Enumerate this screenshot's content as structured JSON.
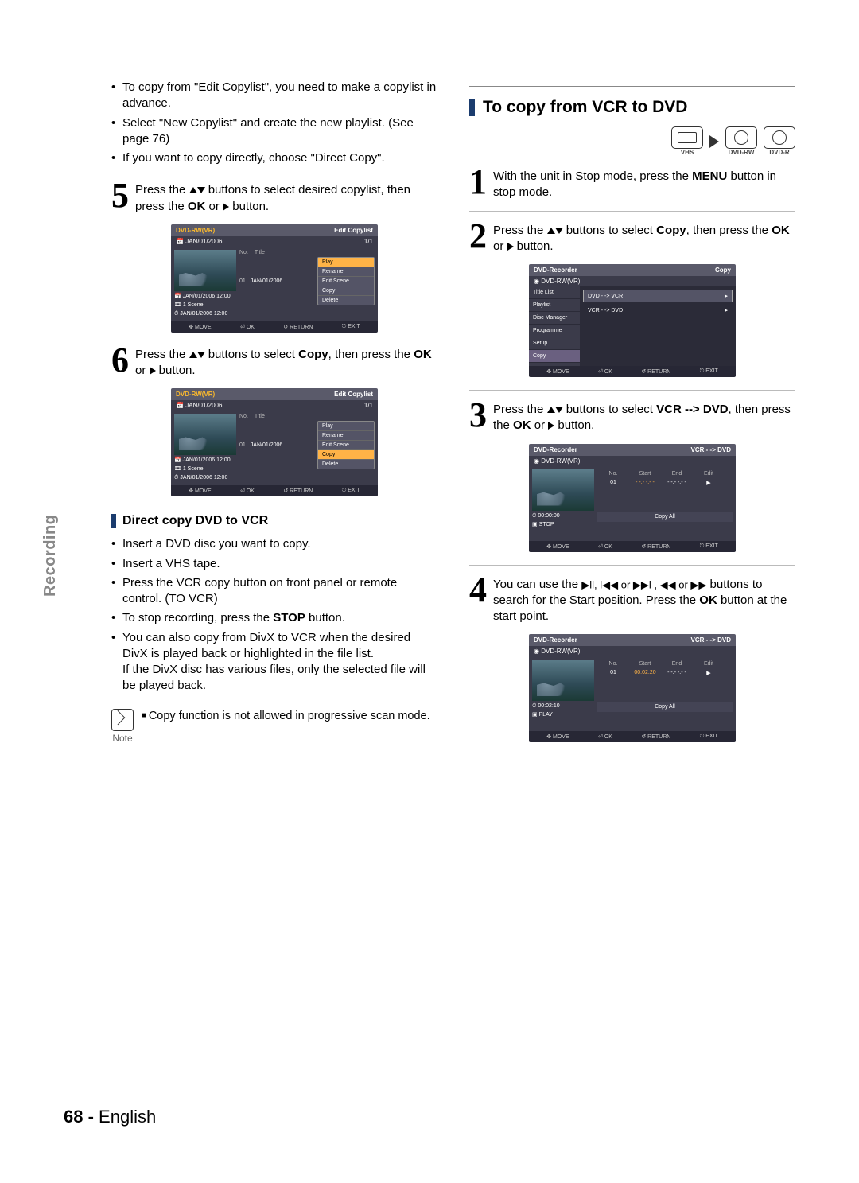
{
  "sidetab": "Recording",
  "footer": {
    "page": "68 -",
    "lang": "English"
  },
  "left": {
    "pre_bullets": [
      "To copy from \"Edit Copylist\", you need to make a copylist in advance.",
      "Select \"New Copylist\" and create the new playlist. (See page 76)",
      "If you want to copy directly, choose \"Direct Copy\"."
    ],
    "step5": {
      "num": "5",
      "text_a": "Press the ",
      "text_b": " buttons to select desired copylist, then press the ",
      "ok": "OK",
      "text_c": " or ",
      "text_d": " button."
    },
    "osd1": {
      "title_l": "DVD-RW(VR)",
      "title_r": "Edit Copylist",
      "sub_l": "JAN/01/2006",
      "sub_r": "1/1",
      "cols": {
        "no": "No.",
        "title": "Title"
      },
      "row_idx": "01",
      "row_title": "JAN/01/2006",
      "meta1": "JAN/01/2006 12:00",
      "meta2": "1 Scene",
      "meta3": "JAN/01/2006 12:00",
      "popup": [
        "Play",
        "Rename",
        "Edit Scene",
        "Copy",
        "Delete"
      ],
      "foot": {
        "move": "MOVE",
        "ok": "OK",
        "return": "RETURN",
        "exit": "EXIT"
      }
    },
    "step6": {
      "num": "6",
      "text_a": "Press the ",
      "text_b": " buttons to select ",
      "copy": "Copy",
      "text_c": ", then press the ",
      "ok": "OK",
      "text_d": " or ",
      "text_e": " button."
    },
    "subhead": "Direct copy DVD to VCR",
    "direct_bullets": [
      "Insert a DVD disc you want to copy.",
      "Insert a VHS tape.",
      "Press the VCR copy button on front panel or remote control. (TO VCR)",
      "To stop recording, press the STOP button.",
      "You can also copy from DivX to VCR when the desired DivX is played back or highlighted in the file list.\nIf the DivX disc has various files, only the selected file will be played back."
    ],
    "stop_bold": "STOP",
    "note_label": "Note",
    "note_text": "Copy function is not allowed in progressive scan mode."
  },
  "right": {
    "mainhead": "To copy from VCR to DVD",
    "devices": {
      "vhs": "VHS",
      "rw": "DVD-RW",
      "r": "DVD-R"
    },
    "step1": {
      "num": "1",
      "a": "With the unit in Stop mode, press the ",
      "menu": "MENU",
      "b": " button in stop mode."
    },
    "step2": {
      "num": "2",
      "a": "Press the ",
      "b": " buttons to select ",
      "copy": "Copy",
      "c": ", then press the ",
      "ok": "OK",
      "d": " or ",
      "e": " button."
    },
    "osd2": {
      "title_l": "DVD-Recorder",
      "title_r": "Copy",
      "sub": "DVD-RW(VR)",
      "left_items": [
        "Title List",
        "Playlist",
        "Disc Manager",
        "Programme",
        "Setup",
        "Copy"
      ],
      "opt1": "DVD - -> VCR",
      "opt2": "VCR - -> DVD",
      "foot": {
        "move": "MOVE",
        "ok": "OK",
        "return": "RETURN",
        "exit": "EXIT"
      }
    },
    "step3": {
      "num": "3",
      "a": "Press the ",
      "b": " buttons to select ",
      "vd": "VCR --> DVD",
      "c": ", then press the ",
      "ok": "OK",
      "d": " or ",
      "e": " button."
    },
    "osd3": {
      "title_l": "DVD-Recorder",
      "title_r": "VCR - -> DVD",
      "sub": "DVD-RW(VR)",
      "cols": {
        "no": "No.",
        "start": "Start",
        "end": "End",
        "edit": "Edit"
      },
      "row": {
        "no": "01",
        "start": "- -:- -:- -",
        "end": "- -:- -:- -",
        "edit": "▶"
      },
      "time": "00:00:00",
      "state": "STOP",
      "copyall": "Copy All",
      "foot": {
        "move": "MOVE",
        "ok": "OK",
        "return": "RETURN",
        "exit": "EXIT"
      }
    },
    "step4": {
      "num": "4",
      "a": "You can use the ",
      "b": " buttons to search for the Start position. Press the ",
      "ok": "OK",
      "c": " button at the start point.",
      "icons": "▶ll, l◀◀ or ▶▶l , ◀◀ or ▶▶"
    },
    "osd4": {
      "title_l": "DVD-Recorder",
      "title_r": "VCR - -> DVD",
      "sub": "DVD-RW(VR)",
      "cols": {
        "no": "No.",
        "start": "Start",
        "end": "End",
        "edit": "Edit"
      },
      "row": {
        "no": "01",
        "start": "00:02:20",
        "end": "- -:- -:- -",
        "edit": "▶"
      },
      "time": "00:02:10",
      "state": "PLAY",
      "copyall": "Copy All",
      "foot": {
        "move": "MOVE",
        "ok": "OK",
        "return": "RETURN",
        "exit": "EXIT"
      }
    }
  }
}
